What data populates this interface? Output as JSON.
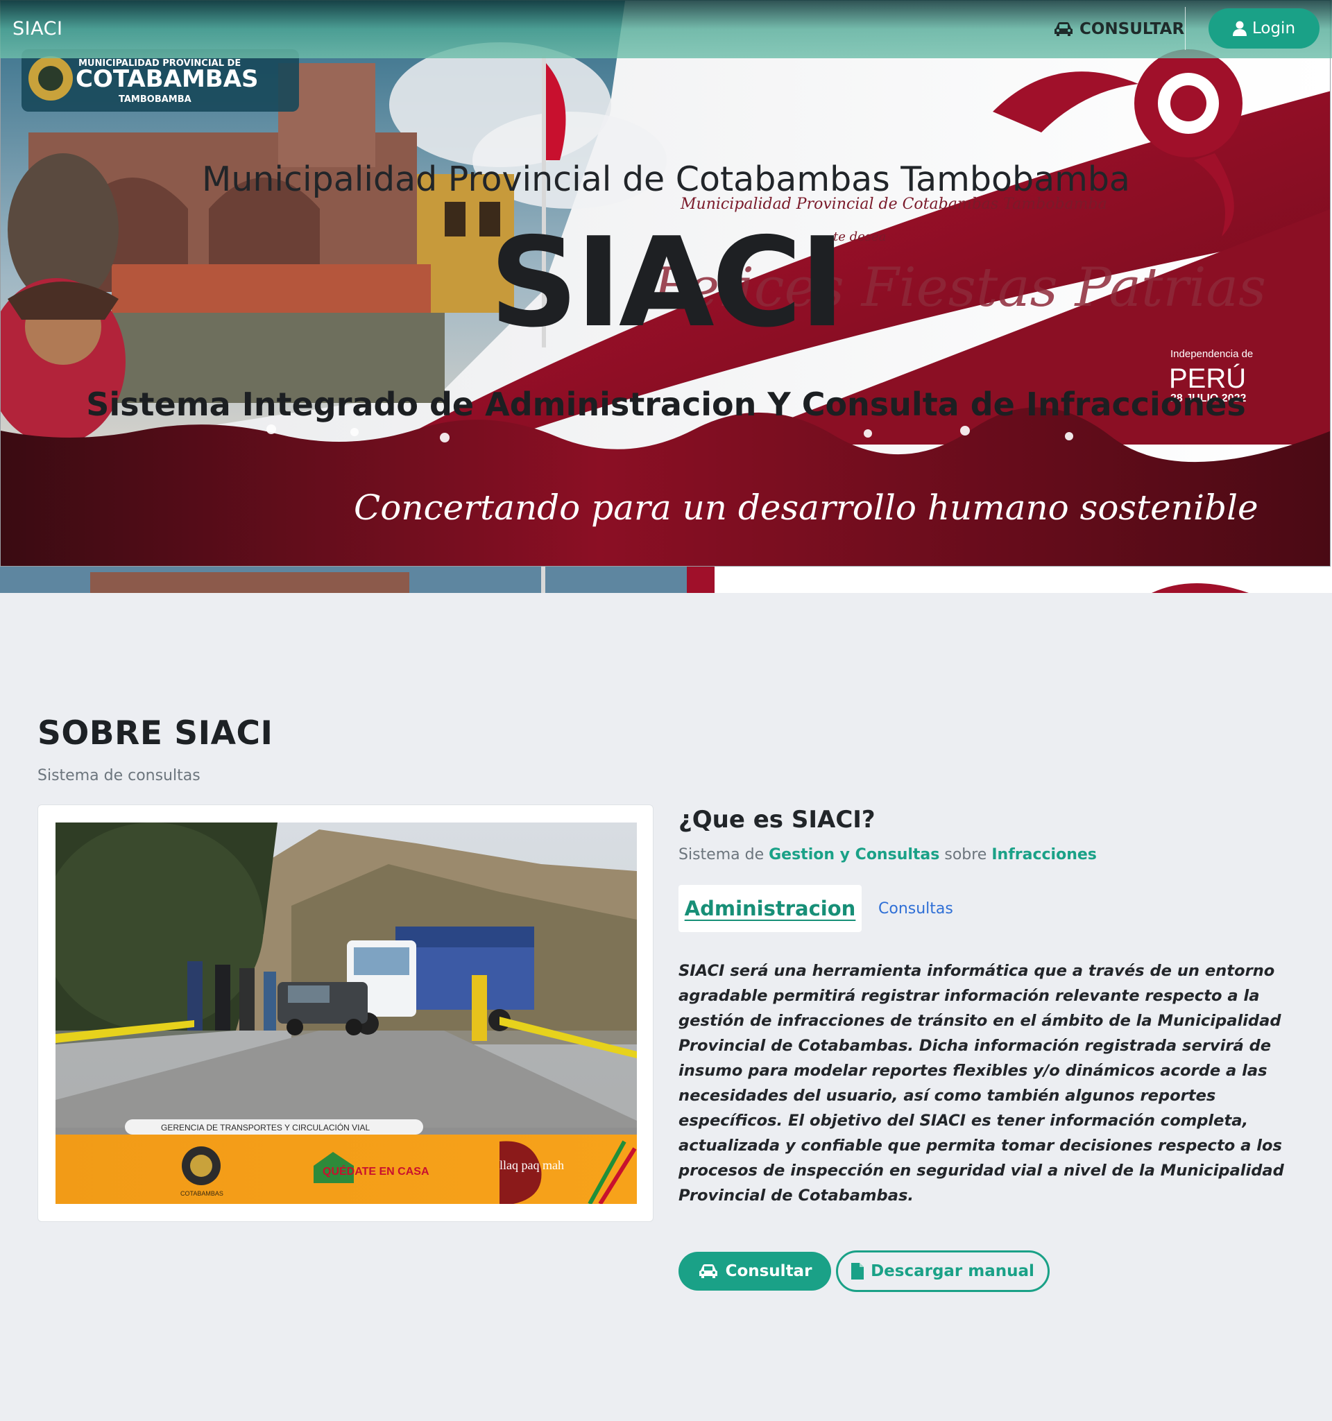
{
  "colors": {
    "accent": "#1aa187",
    "accent_dark": "#178f77",
    "link": "#2f6fd6",
    "page_bg": "#eceef2",
    "banner_red": "#8b0f24"
  },
  "navbar": {
    "brand": "SIACI",
    "consult_link": "CONSULTAR",
    "consult_icon": "car-icon",
    "login_label": "Login",
    "login_icon": "user-icon"
  },
  "hero": {
    "title": "Municipalidad Provincial de Cotabambas Tambobamba",
    "brand": "SIACI",
    "subtitle": "Sistema Integrado de Administracion Y Consulta de Infracciones",
    "banner": {
      "logo_top": "MUNICIPALIDAD PROVINCIAL DE",
      "logo_main": "COTABAMBAS",
      "logo_bottom": "TAMBOBAMBA",
      "greeting_small": "Municipalidad Provincial de Cotabambas Tambobamba",
      "greeting_mid": "te desea",
      "greeting_big": "Felices Fiestas Patrias",
      "badge_top": "Independencia de",
      "badge_country": "PERÚ",
      "badge_date": "28 JULIO 2022",
      "slogan": "Concertando para un desarrollo humano sostenible"
    }
  },
  "about": {
    "title": "SOBRE SIACI",
    "subtitle": "Sistema de consultas",
    "photo": {
      "caption": "GERENCIA DE TRANSPORTES Y CIRCULACIÓN VIAL",
      "logo_left": "COTABAMBAS",
      "logo_mid": "QUÉDATE EN CASA",
      "logo_right": "llaq paq mah"
    },
    "question": "¿Que es SIACI?",
    "lead_1": "Sistema de ",
    "lead_hl_1": "Gestion y Consultas",
    "lead_2": " sobre ",
    "lead_hl_2": "Infracciones",
    "tabs": [
      "Administracion",
      "Consultas"
    ],
    "description": "SIACI será una herramienta informática que a través de un entorno agradable permitirá registrar información relevante respecto a la gestión de infracciones de tránsito en el ámbito de la Municipalidad Provincial de Cotabambas. Dicha información registrada servirá de insumo para modelar reportes flexibles y/o dinámicos acorde a las necesidades del usuario, así como también algunos reportes específicos. El objetivo del SIACI es tener información completa, actualizada y confiable que permita tomar decisiones respecto a los procesos de inspección en seguridad vial a nivel de la Municipalidad Provincial de Cotabambas.",
    "buttons": {
      "consult": "Consultar",
      "consult_icon": "car-icon",
      "manual": "Descargar manual",
      "manual_icon": "file-icon"
    }
  }
}
